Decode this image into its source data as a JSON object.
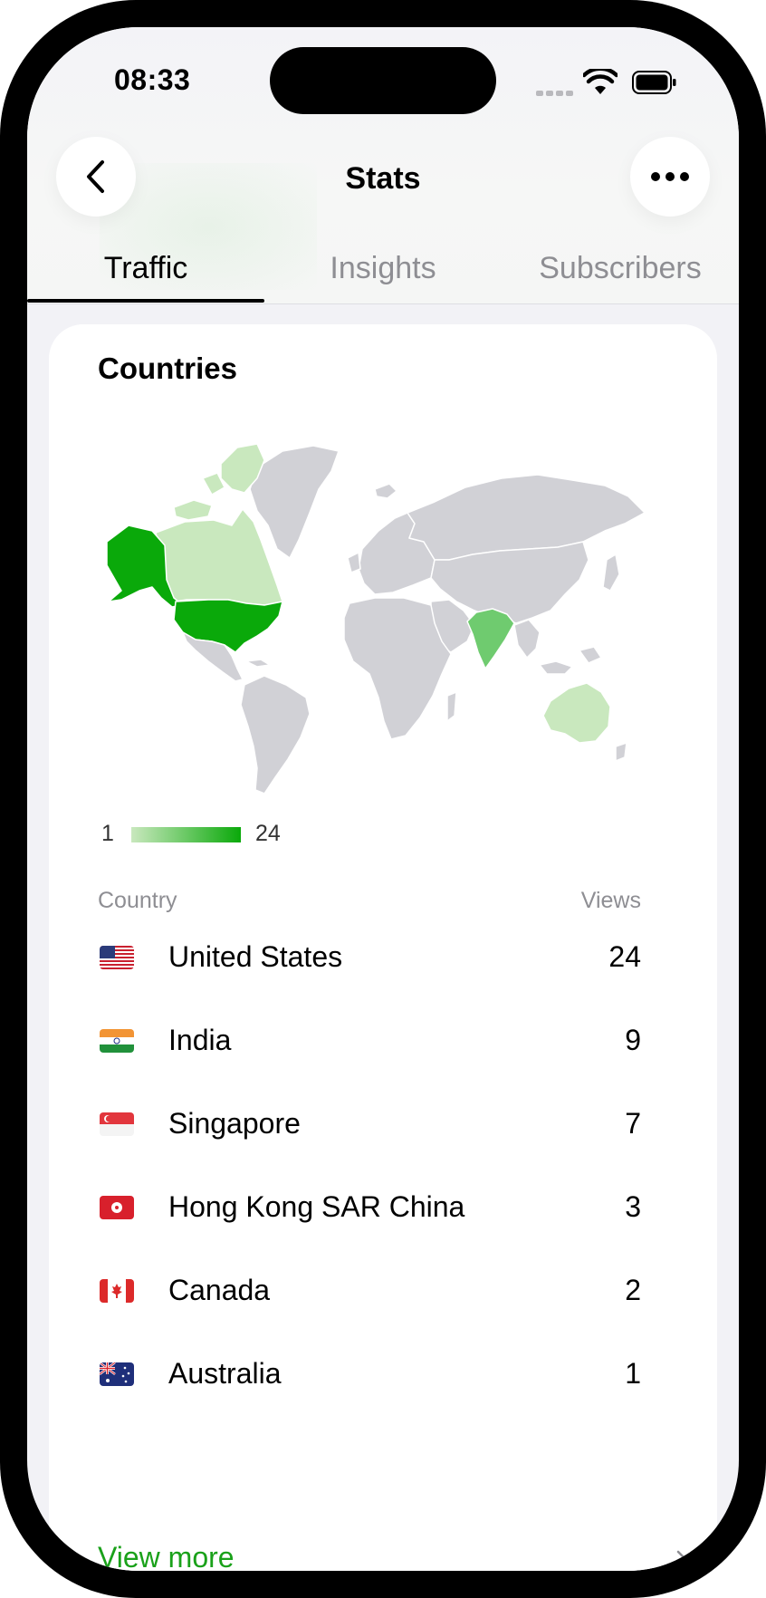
{
  "status_bar": {
    "time": "08:33"
  },
  "header": {
    "title": "Stats",
    "back_icon": "chevron-left-icon",
    "more_icon": "ellipsis-icon"
  },
  "tabs": [
    {
      "label": "Traffic",
      "active": true
    },
    {
      "label": "Insights",
      "active": false
    },
    {
      "label": "Subscribers",
      "active": false
    }
  ],
  "countries_card": {
    "title": "Countries",
    "legend": {
      "min": "1",
      "max": "24",
      "min_color": "#c9e8be",
      "max_color": "#0aa90a"
    },
    "columns": {
      "country": "Country",
      "views": "Views"
    },
    "rows": [
      {
        "name": "United States",
        "views": "24",
        "flag": "us-flag-icon"
      },
      {
        "name": "India",
        "views": "9",
        "flag": "india-flag-icon"
      },
      {
        "name": "Singapore",
        "views": "7",
        "flag": "singapore-flag-icon"
      },
      {
        "name": "Hong Kong SAR China",
        "views": "3",
        "flag": "hong-kong-flag-icon"
      },
      {
        "name": "Canada",
        "views": "2",
        "flag": "canada-flag-icon"
      },
      {
        "name": "Australia",
        "views": "1",
        "flag": "australia-flag-icon"
      }
    ],
    "view_more": "View more"
  },
  "colors": {
    "accent": "#1aa11a",
    "map_land": "#d1d1d6"
  }
}
